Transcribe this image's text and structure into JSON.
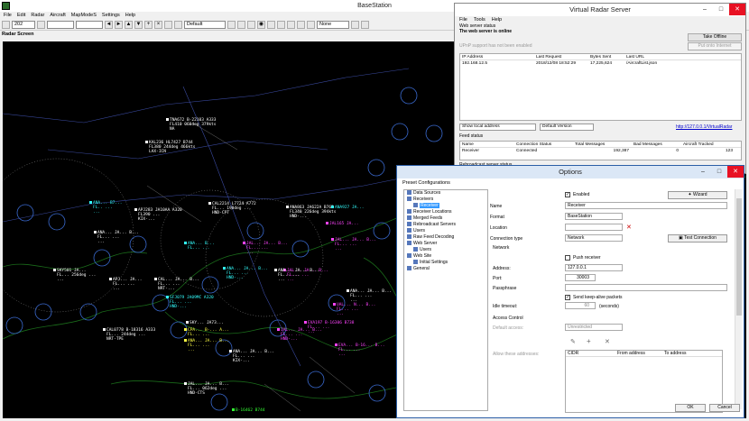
{
  "basestation": {
    "title": "BaseStation",
    "menu": [
      "File",
      "Edit",
      "Radar",
      "Aircraft",
      "MapModeS",
      "Settings",
      "Help"
    ],
    "toolbar": {
      "zoom": "202",
      "map": "Default",
      "filter": "None"
    },
    "radar_label": "Radar Screen"
  },
  "aircraft": [
    {
      "lines": [
        "TNA672 B-22103 A333",
        "FL410 060deg 379kts",
        "NA"
      ],
      "color": "white"
    },
    {
      "lines": [
        "KAL236 HL7427 B744",
        "FL380 244deg 466kts",
        "LAX-ICN"
      ],
      "color": "white"
    },
    {
      "lines": [
        "ANA... B7...",
        "FL.. ...",
        "..."
      ],
      "color": "cyan"
    },
    {
      "lines": [
        "APJ283 JA10AA A320",
        "FL390 ...",
        "KIX-..."
      ],
      "color": "white"
    },
    {
      "lines": [
        "ANA... JA... B...",
        "FL... ...",
        "..."
      ],
      "color": "white"
    },
    {
      "lines": [
        "CAL2214 L7724 A772",
        "FL... 198deg ...",
        "HND-CPT"
      ],
      "color": "white"
    },
    {
      "lines": [
        "ANA863 JA622A B763",
        "FL340 226deg 394kts",
        "HND-..."
      ],
      "color": "white"
    },
    {
      "lines": [
        "ANA927 JA..."
      ],
      "color": "cyan"
    },
    {
      "lines": [
        "JAL165 JA..."
      ],
      "color": "magenta"
    },
    {
      "lines": [
        "SKY501 JA...",
        "FL... 256deg ...",
        "..."
      ],
      "color": "white"
    },
    {
      "lines": [
        "APJ... JA...",
        "FL... ...",
        "..."
      ],
      "color": "white"
    },
    {
      "lines": [
        "ANA... B...",
        "FL... ..."
      ],
      "color": "cyan"
    },
    {
      "lines": [
        "CAL... JA... B...",
        "FL... ...",
        "NRT-..."
      ],
      "color": "white"
    },
    {
      "lines": [
        "JAL... JA... B...",
        "FL... ...",
        "..."
      ],
      "color": "magenta"
    },
    {
      "lines": [
        "ANA... JA... B...",
        "FL... ...",
        "HND-..."
      ],
      "color": "cyan"
    },
    {
      "lines": [
        "JAL... JA... B...",
        "FL... ...",
        "..."
      ],
      "color": "magenta"
    },
    {
      "lines": [
        "JAL... JA... B...",
        "FL... ...",
        "..."
      ],
      "color": "magenta"
    },
    {
      "lines": [
        "SFJ079 JA09MC A320",
        "FL... ...",
        "HND-..."
      ],
      "color": "cyan"
    },
    {
      "lines": [
        "CAL0778 B-18316 A333",
        "FL... 244deg ...",
        "NRT-TPE"
      ],
      "color": "white"
    },
    {
      "lines": [
        "SKY... JA73..."
      ],
      "color": "white"
    },
    {
      "lines": [
        "CPA... B-... A...",
        "FL... ..."
      ],
      "color": "yellow"
    },
    {
      "lines": [
        "ANA... JA... B...",
        "FL... ...",
        "..."
      ],
      "color": "yellow"
    },
    {
      "lines": [
        "EVA197 B-16306 B738",
        "FL... ...",
        "..."
      ],
      "color": "magenta"
    },
    {
      "lines": [
        "JAL... JA... B...",
        "FL... ...",
        "HND-..."
      ],
      "color": "magenta"
    },
    {
      "lines": [
        "ANA... JA... B...",
        "FL... ...",
        "KIX-..."
      ],
      "color": "white"
    },
    {
      "lines": [
        "UAL... N... B...",
        "FL... ...",
        "..."
      ],
      "color": "magenta"
    },
    {
      "lines": [
        "ANA... JA... B...",
        "FL... ...",
        "..."
      ],
      "color": "white"
    },
    {
      "lines": [
        "EVA... B-16... B...",
        "FL... ...",
        "..."
      ],
      "color": "magenta"
    },
    {
      "lines": [
        "JAL... JA... B...",
        "FL... 062deg ...",
        "HND-CTS"
      ],
      "color": "white"
    },
    {
      "lines": [
        "ANA... JA... B...",
        "FL... ...",
        "..."
      ],
      "color": "white"
    },
    {
      "lines": [
        "B-16462 B744"
      ],
      "color": "green"
    }
  ],
  "vrs": {
    "title": "Virtual Radar Server",
    "menu": [
      "File",
      "Tools",
      "Help"
    ],
    "web_server_status_label": "Web server status",
    "web_server_online": "The web server is online",
    "take_offline": "Take Offline",
    "upnp_msg": "UPnP support has not been enabled",
    "put_onto_internet": "Put onto Internet",
    "request_headers": [
      "IP Address",
      "Last Request",
      "Bytes Sent",
      "Last URL"
    ],
    "request_rows": [
      [
        "192.168.12.5",
        "2018/12/08 18:52:29",
        "17,225,624",
        "/AircraftList.json"
      ]
    ],
    "show_address": "Show local address",
    "version": "Default Version",
    "url": "http://127.0.0.1/VirtualRadar",
    "feed_status_label": "Feed status",
    "feed_headers": [
      "Name",
      "Connection Status",
      "Total Messages",
      "Bad Messages",
      "Aircraft Tracked"
    ],
    "feed_rows": [
      [
        "Receiver",
        "Connected",
        "192,387",
        "0",
        "123"
      ]
    ],
    "rebroadcast_label": "Rebroadcast server status"
  },
  "options": {
    "title": "Options",
    "preset": "Preset Configurations",
    "tree": [
      {
        "label": "Data Sources",
        "indent": 0
      },
      {
        "label": "Receivers",
        "indent": 0
      },
      {
        "label": "Receiver",
        "indent": 1,
        "selected": true
      },
      {
        "label": "Receiver Locations",
        "indent": 0
      },
      {
        "label": "Merged Feeds",
        "indent": 0
      },
      {
        "label": "Rebroadcast Servers",
        "indent": 0
      },
      {
        "label": "Users",
        "indent": 0
      },
      {
        "label": "Raw Feed Decoding",
        "indent": 0
      },
      {
        "label": "Web Server",
        "indent": 0
      },
      {
        "label": "Users",
        "indent": 1
      },
      {
        "label": "Web Site",
        "indent": 0
      },
      {
        "label": "Initial Settings",
        "indent": 1
      },
      {
        "label": "General",
        "indent": 0
      }
    ],
    "enabled_label": "Enabled",
    "enabled": true,
    "wizard": "Wizard",
    "name_label": "Name",
    "name_value": "Receiver",
    "format_label": "Format",
    "format_value": "BaseStation",
    "location_label": "Location",
    "location_value": "",
    "connection_type_label": "Connection type",
    "connection_type_value": "Network",
    "test_connection": "Test Connection",
    "network_label": "Network",
    "push_receiver": "Push receiver",
    "address_label": "Address:",
    "address_value": "127.0.0.1",
    "port_label": "Port:",
    "port_value": "30003",
    "passphrase_label": "Passphrase",
    "send_keepalive": "Send keep-alive packets",
    "idle_timeout_label": "Idle timeout:",
    "idle_timeout_value": "60",
    "idle_timeout_unit": "(seconds)",
    "access_control_label": "Access Control",
    "default_access_label": "Default access:",
    "default_access_value": "Unrestricted",
    "allow_label": "Allow these addresses:",
    "acl_headers": [
      "CIDR",
      "From address",
      "To address"
    ],
    "ok": "OK",
    "cancel": "Cancel"
  }
}
